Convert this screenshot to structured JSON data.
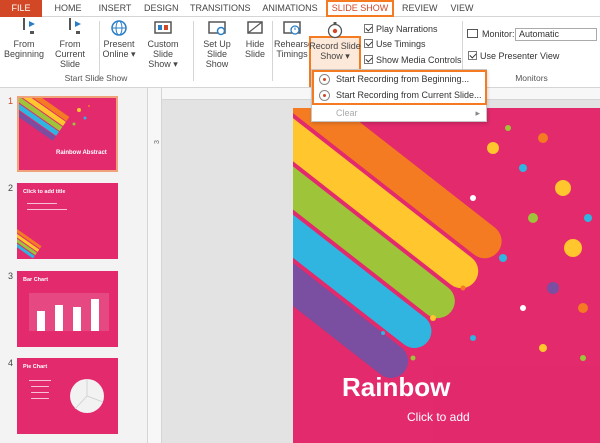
{
  "tabs": {
    "file": "FILE",
    "home": "HOME",
    "insert": "INSERT",
    "design": "DESIGN",
    "transitions": "TRANSITIONS",
    "animations": "ANIMATIONS",
    "slide_show": "SLIDE SHOW",
    "review": "REVIEW",
    "view": "VIEW"
  },
  "ribbon": {
    "start_group": {
      "label": "Start Slide Show",
      "from_beginning": [
        "From",
        "Beginning"
      ],
      "from_current": [
        "From",
        "Current Slide"
      ],
      "present_online": [
        "Present",
        "Online ▾"
      ],
      "custom_show": [
        "Custom Slide",
        "Show ▾"
      ]
    },
    "setup_group": {
      "set_up": [
        "Set Up",
        "Slide Show"
      ],
      "hide": [
        "Hide",
        "Slide"
      ],
      "rehearse": [
        "Rehearse",
        "Timings"
      ],
      "record": [
        "Record Slide",
        "Show ▾"
      ],
      "play_narrations": "Play Narrations",
      "use_timings": "Use Timings",
      "show_media_controls": "Show Media Controls"
    },
    "monitors_group": {
      "label": "Monitors",
      "monitor_label": "Monitor:",
      "monitor_value": "Automatic",
      "presenter_view": "Use Presenter View"
    }
  },
  "menu": {
    "items": [
      "Start Recording from Beginning...",
      "Start Recording from Current Slide...",
      "Clear"
    ]
  },
  "slides": [
    {
      "num": "1",
      "title": "Rainbow Abstract"
    },
    {
      "num": "2",
      "title": "Click to add title"
    },
    {
      "num": "3",
      "title": "Bar Chart"
    },
    {
      "num": "4",
      "title": "Pie Chart"
    }
  ],
  "ruler": {
    "v_mark": "3"
  },
  "main_slide": {
    "title": "Rainbow",
    "subtitle": "Click to add"
  },
  "colors": {
    "accent": "#d24726",
    "highlight": "#f47b22",
    "slide_bg": "#e22a6d"
  }
}
